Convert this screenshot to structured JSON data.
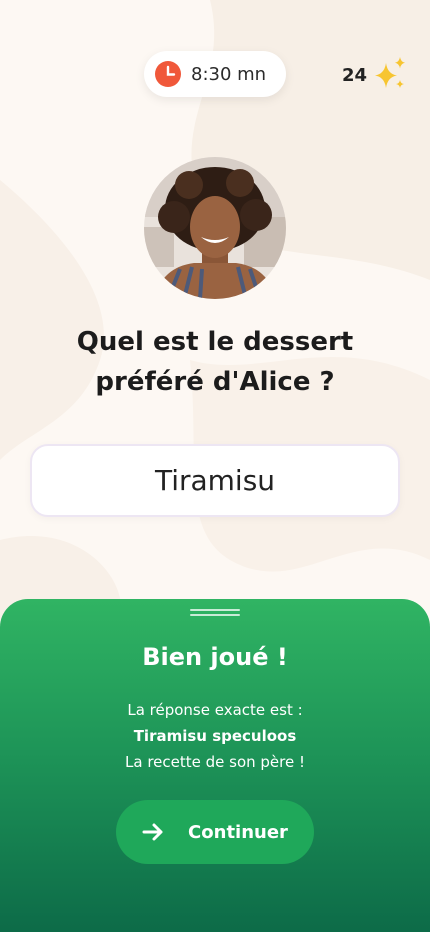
{
  "header": {
    "timer": "8:30 mn",
    "score": "24"
  },
  "question": {
    "line1": "Quel est le dessert",
    "line2": "préféré d'Alice ?"
  },
  "answer": {
    "value": "Tiramisu"
  },
  "result": {
    "title": "Bien joué !",
    "line1": "La réponse exacte est :",
    "line2": "Tiramisu speculoos",
    "line3": "La recette de son père !",
    "button_label": "Continuer"
  },
  "icons": {
    "timer": "clock-icon",
    "score": "sparkle-icon",
    "button": "arrow-right-icon"
  },
  "colors": {
    "accent_green": "#1fa85a",
    "clock_red": "#f0583a",
    "sparkle_yellow": "#f7c531"
  }
}
